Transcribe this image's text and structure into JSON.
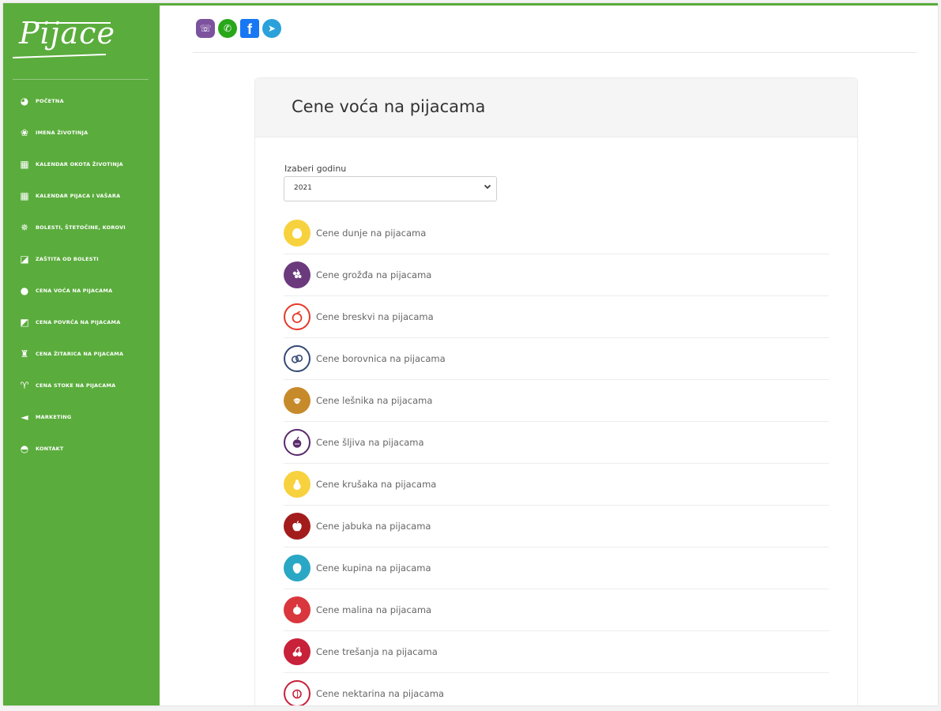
{
  "colors": {
    "brand_green": "#5aac3c",
    "page_bg": "#f3f3f3",
    "text_gray": "#666666"
  },
  "brand": {
    "logo_text": "Pijace"
  },
  "sidebar": {
    "items": [
      {
        "label": "Početna",
        "icon": "globe-icon"
      },
      {
        "label": "Imena životinja",
        "icon": "paw-icon"
      },
      {
        "label": "Kalendar okota životinja",
        "icon": "calendar-icon"
      },
      {
        "label": "Kalendar pijaca i vašara",
        "icon": "calendar-icon"
      },
      {
        "label": "Bolesti, štetočine, korovi",
        "icon": "bug-icon"
      },
      {
        "label": "Zaštita od bolesti",
        "icon": "spray-icon"
      },
      {
        "label": "Cena voća na pijacama",
        "icon": "apple-icon"
      },
      {
        "label": "Cena povrća na pijacama",
        "icon": "vegetable-icon"
      },
      {
        "label": "Cena žitarica na pijacama",
        "icon": "grain-bag-icon"
      },
      {
        "label": "Cena stoke na pijacama",
        "icon": "cow-icon"
      },
      {
        "label": "Marketing",
        "icon": "megaphone-icon"
      },
      {
        "label": "Kontakt",
        "icon": "chat-icon"
      }
    ]
  },
  "social": [
    {
      "name": "viber",
      "color": "#7c529e",
      "glyph": "☏"
    },
    {
      "name": "whatsapp",
      "color": "#29a71a",
      "glyph": "✆"
    },
    {
      "name": "facebook",
      "color": "#1877f2",
      "glyph": "f"
    },
    {
      "name": "telegram",
      "color": "#2aa1da",
      "glyph": "➤"
    }
  ],
  "main": {
    "title": "Cene voća na pijacama",
    "year_label": "Izaberi godinu",
    "year_selected": "2021"
  },
  "fruits": [
    {
      "label": "Cene dunje na pijacama",
      "icon": "quince-icon",
      "color": "#f7d23e",
      "style": "fill"
    },
    {
      "label": "Cene grožđa na pijacama",
      "icon": "grape-icon",
      "color": "#6b3a7d",
      "style": "fill"
    },
    {
      "label": "Cene breskvi na pijacama",
      "icon": "peach-icon",
      "color": "#e5392a",
      "style": "ring"
    },
    {
      "label": "Cene borovnica na pijacama",
      "icon": "blueberry-icon",
      "color": "#344a74",
      "style": "ring"
    },
    {
      "label": "Cene lešnika na pijacama",
      "icon": "hazelnut-icon",
      "color": "#c78a2b",
      "style": "fill"
    },
    {
      "label": "Cene šljiva na pijacama",
      "icon": "plum-icon",
      "color": "#5a2b6b",
      "style": "ring"
    },
    {
      "label": "Cene krušaka na pijacama",
      "icon": "pear-icon",
      "color": "#f7d23e",
      "style": "fill"
    },
    {
      "label": "Cene jabuka na pijacama",
      "icon": "apple-icon",
      "color": "#a31c1c",
      "style": "fill"
    },
    {
      "label": "Cene kupina na pijacama",
      "icon": "blackberry-icon",
      "color": "#2aa7c4",
      "style": "fill"
    },
    {
      "label": "Cene malina na pijacama",
      "icon": "raspberry-icon",
      "color": "#d9363e",
      "style": "fill"
    },
    {
      "label": "Cene trešanja na pijacama",
      "icon": "cherry-icon",
      "color": "#c8213a",
      "style": "fill"
    },
    {
      "label": "Cene nektarina na pijacama",
      "icon": "nectarine-icon",
      "color": "#c8213a",
      "style": "ring"
    }
  ]
}
